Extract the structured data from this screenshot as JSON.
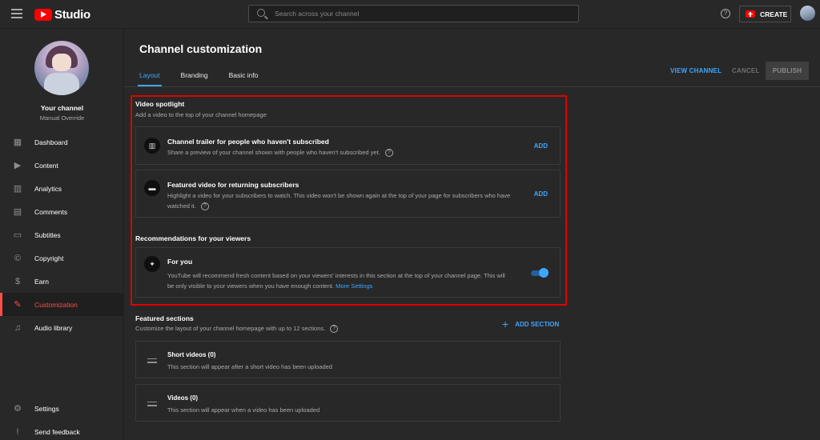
{
  "topbar": {
    "logo_text": "Studio",
    "search_placeholder": "Search across your channel",
    "help_label": "?",
    "create_label": "CREATE"
  },
  "sidebar": {
    "channel_title": "Your channel",
    "channel_name": "Manual Override",
    "items": [
      {
        "label": "Dashboard",
        "icon": "dashboard-icon"
      },
      {
        "label": "Content",
        "icon": "content-icon"
      },
      {
        "label": "Analytics",
        "icon": "analytics-icon"
      },
      {
        "label": "Comments",
        "icon": "comments-icon"
      },
      {
        "label": "Subtitles",
        "icon": "subtitles-icon"
      },
      {
        "label": "Copyright",
        "icon": "copyright-icon"
      },
      {
        "label": "Earn",
        "icon": "dollar-icon"
      },
      {
        "label": "Customization",
        "icon": "magic-wand-icon"
      },
      {
        "label": "Audio library",
        "icon": "audio-library-icon"
      }
    ],
    "bottom_items": [
      {
        "label": "Settings",
        "icon": "gear-icon"
      },
      {
        "label": "Send feedback",
        "icon": "feedback-icon"
      }
    ],
    "active_item": "Customization"
  },
  "main": {
    "title": "Channel customization",
    "tabs": [
      {
        "label": "Layout"
      },
      {
        "label": "Branding"
      },
      {
        "label": "Basic info"
      }
    ],
    "active_tab": "Layout",
    "view_channel_label": "VIEW CHANNEL",
    "cancel_label": "CANCEL",
    "publish_label": "PUBLISH",
    "video_spotlight": {
      "title": "Video spotlight",
      "description": "Add a video to the top of your channel homepage",
      "trailer": {
        "title": "Channel trailer for people who haven't subscribed",
        "description": "Share a preview of your channel shown with people who haven't subscribed yet.",
        "action": "ADD"
      },
      "featured": {
        "title": "Featured video for returning subscribers",
        "description_line1": "Highlight a video for your subscribers to watch. This video won't be shown again at the top of your page for subscribers who have",
        "description_line2": "watched it.",
        "action": "ADD"
      }
    },
    "recommendations": {
      "title": "Recommendations for your viewers",
      "for_you": {
        "title": "For you",
        "description_line1": "YouTube will recommend fresh content based on your viewers' interests in this section at the top of your channel page. This will",
        "description_line2": "be only visible to your viewers when you have enough content.",
        "link": "More Settings",
        "enabled": true
      }
    },
    "featured_sections": {
      "title": "Featured sections",
      "description": "Customize the layout of your channel homepage with up to 12 sections.",
      "add_label": "ADD SECTION",
      "sections": [
        {
          "title": "Short videos (0)",
          "description": "This section will appear after a short video has been uploaded"
        },
        {
          "title": "Videos (0)",
          "description": "This section will appear when a video has been uploaded"
        }
      ]
    }
  },
  "colors": {
    "accent": "#3ea6ff",
    "active_nav": "#ff4e45",
    "highlight_border": "#e00000",
    "background": "#282828"
  }
}
